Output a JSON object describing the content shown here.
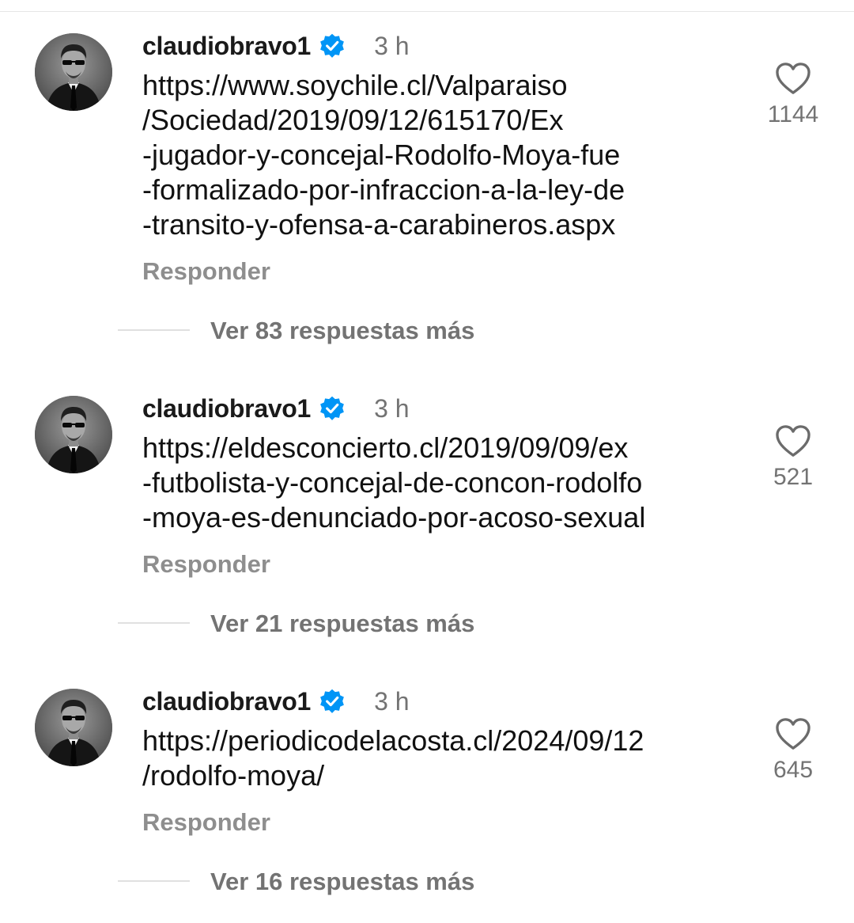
{
  "comments": [
    {
      "username": "claudiobravo1",
      "time": "3 h",
      "text_lines": [
        "https://www.soychile.cl/Valparaiso",
        "/Sociedad/2019/09/12/615170/Ex",
        "-jugador-y-concejal-Rodolfo-Moya-fue",
        "-formalizado-por-infraccion-a-la-ley-de",
        "-transito-y-ofensa-a-carabineros.aspx"
      ],
      "reply_label": "Responder",
      "more_replies": "Ver 83 respuestas más",
      "likes": "1144"
    },
    {
      "username": "claudiobravo1",
      "time": "3 h",
      "text_lines": [
        "https://eldesconcierto.cl/2019/09/09/ex",
        "-futbolista-y-concejal-de-concon-rodolfo",
        "-moya-es-denunciado-por-acoso-sexual"
      ],
      "reply_label": "Responder",
      "more_replies": "Ver 21 respuestas más",
      "likes": "521"
    },
    {
      "username": "claudiobravo1",
      "time": "3 h",
      "text_lines": [
        "https://periodicodelacosta.cl/2024/09/12",
        "/rodolfo-moya/"
      ],
      "reply_label": "Responder",
      "more_replies": "Ver 16 respuestas más",
      "likes": "645"
    }
  ],
  "icons": {
    "verified": "verified-badge-icon",
    "like": "heart-icon"
  },
  "colors": {
    "verified_badge": "#0095f6",
    "secondary_text": "#737373",
    "reply_text": "#8e8e8e"
  }
}
